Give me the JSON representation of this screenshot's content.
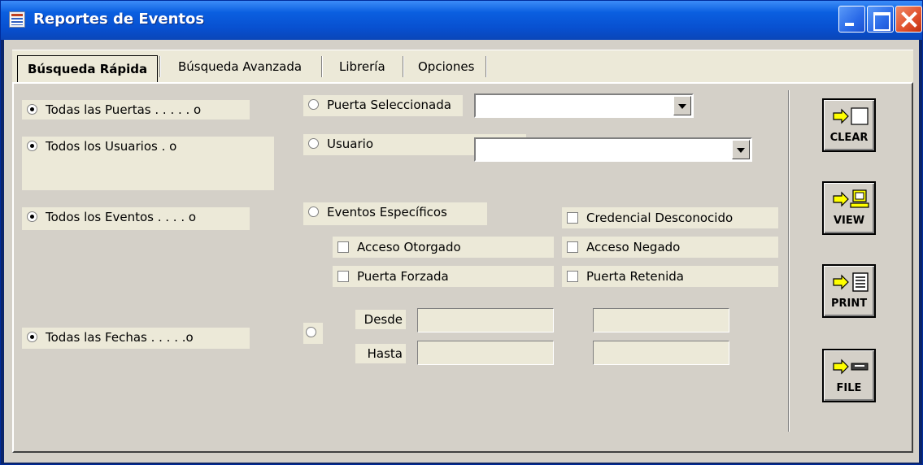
{
  "window": {
    "title": "Reportes de Eventos"
  },
  "tabs": [
    {
      "label": "Búsqueda Rápida",
      "active": true
    },
    {
      "label": "Búsqueda Avanzada",
      "active": false
    },
    {
      "label": "Librería",
      "active": false
    },
    {
      "label": "Opciones",
      "active": false
    }
  ],
  "left_options": {
    "doors": {
      "label": "Todas las Puertas . . . . . o",
      "selected": true
    },
    "users": {
      "label": "Todos los Usuarios . o",
      "selected": true
    },
    "events": {
      "label": "Todos los Eventos . . . . o",
      "selected": true
    },
    "dates": {
      "label": "Todas las Fechas . . . . .o",
      "selected": true
    }
  },
  "right_options": {
    "selected_door": {
      "label": "Puerta Seleccionada",
      "selected": false,
      "value": ""
    },
    "user": {
      "label": "Usuario",
      "selected": false,
      "value": ""
    },
    "specific_events": {
      "label": "Eventos Específicos",
      "selected": false
    },
    "date_range": {
      "selected": false,
      "from_label": "Desde",
      "to_label": "Hasta",
      "from_date": "",
      "from_time": "",
      "to_date": "",
      "to_time": ""
    }
  },
  "event_checks": [
    {
      "label": "Credencial Desconocido",
      "checked": false
    },
    {
      "label": "Acceso Otorgado",
      "checked": false
    },
    {
      "label": "Acceso Negado",
      "checked": false
    },
    {
      "label": "Puerta Forzada",
      "checked": false
    },
    {
      "label": "Puerta Retenida",
      "checked": false
    }
  ],
  "actions": {
    "clear": "CLEAR",
    "view": "VIEW",
    "print": "PRINT",
    "file": "FILE"
  },
  "colors": {
    "titlebar": "#0a5fe0",
    "face": "#d4d0c8",
    "label_bg": "#ece9d8",
    "arrow_yellow": "#ffff00"
  }
}
